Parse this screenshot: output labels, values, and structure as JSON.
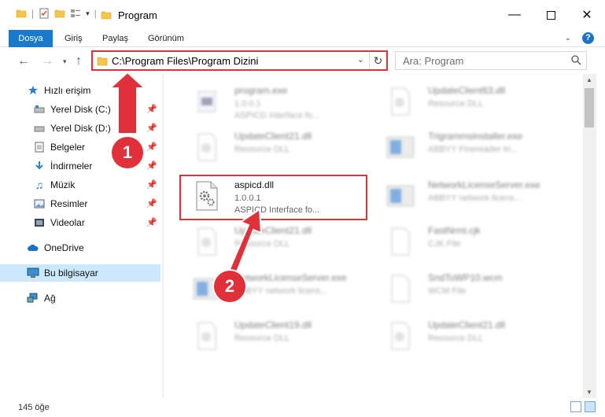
{
  "window": {
    "title": "Program",
    "controls": [
      "minimize-icon",
      "maximize-icon",
      "close-icon"
    ]
  },
  "ribbon": {
    "tabs": [
      {
        "label": "Dosya",
        "active": true
      },
      {
        "label": "Giriş"
      },
      {
        "label": "Paylaş"
      },
      {
        "label": "Görünüm"
      }
    ]
  },
  "nav": {
    "address": "C:\\Program Files\\Program Dizini",
    "search_placeholder": "Ara: Program"
  },
  "sidebar": {
    "items": [
      {
        "label": "Hızlı erişim",
        "icon": "star-icon",
        "pinned": false
      },
      {
        "label": "Yerel Disk (C:)",
        "icon": "drive-icon",
        "pinned": true
      },
      {
        "label": "Yerel Disk (D:)",
        "icon": "drive-icon",
        "pinned": true
      },
      {
        "label": "Belgeler",
        "icon": "documents-icon",
        "pinned": true
      },
      {
        "label": "İndirmeler",
        "icon": "download-icon",
        "pinned": true
      },
      {
        "label": "Müzik",
        "icon": "music-icon",
        "pinned": true
      },
      {
        "label": "Resimler",
        "icon": "pictures-icon",
        "pinned": true
      },
      {
        "label": "Videolar",
        "icon": "videos-icon",
        "pinned": true
      },
      {
        "label": "OneDrive",
        "icon": "cloud-icon",
        "pinned": false
      },
      {
        "label": "Bu bilgisayar",
        "icon": "computer-icon",
        "selected": true
      },
      {
        "label": "Ağ",
        "icon": "network-icon",
        "pinned": false
      }
    ]
  },
  "files": {
    "left": [
      {
        "name": "program.exe",
        "version": "1.0.0.1",
        "desc": "ASPICD Interface fo...",
        "icon": "exe-icon"
      },
      {
        "name": "UpdateClient21.dll",
        "version": "Resource DLL",
        "desc": "",
        "icon": "dll-icon"
      },
      {
        "name": "aspicd.dll",
        "version": "1.0.0.1",
        "desc": "ASPICD Interface fo...",
        "icon": "dll-gear-icon",
        "highlighted": true
      },
      {
        "name": "UpdateClient21.dll",
        "version": "Resource DLL",
        "desc": "",
        "icon": "dll-icon"
      },
      {
        "name": "NetworkLicenseServer.exe",
        "version": "ABBYY network licens...",
        "desc": "",
        "icon": "app-icon"
      },
      {
        "name": "UpdateClient19.dll",
        "version": "Resource DLL",
        "desc": "",
        "icon": "dll-icon"
      }
    ],
    "right": [
      {
        "name": "UpdateClient63.dll",
        "version": "Resource DLL",
        "icon": "dll-icon"
      },
      {
        "name": "Trigrammsinstaller.exe",
        "version": "ABBYY Finereader tri...",
        "icon": "app-icon"
      },
      {
        "name": "NetworkLicenseServer.exe",
        "version": "ABBYY network licens...",
        "icon": "app-icon"
      },
      {
        "name": "FastNrml.cjk",
        "version": "CJK File",
        "icon": "blank-file-icon"
      },
      {
        "name": "SndToWP10.wcm",
        "version": "WCM File",
        "icon": "blank-file-icon"
      },
      {
        "name": "UpdateClient21.dll",
        "version": "Resource DLL",
        "icon": "dll-icon"
      }
    ]
  },
  "status": {
    "count": "145 öğe"
  },
  "annotations": {
    "step1": "1",
    "step2": "2",
    "color": "#e0313b"
  }
}
